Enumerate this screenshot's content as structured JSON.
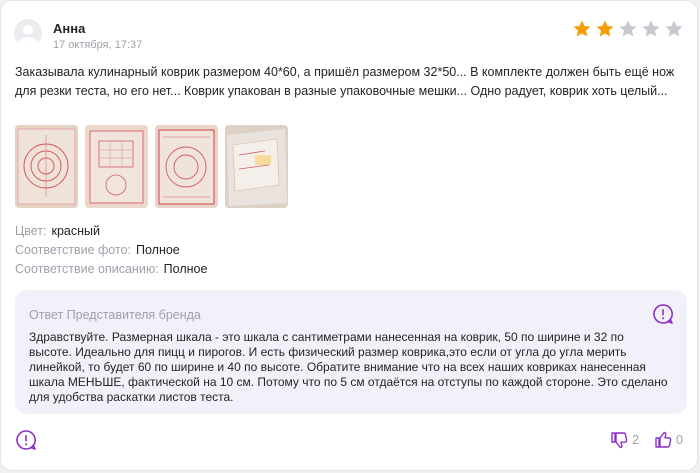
{
  "review": {
    "author": "Анна",
    "date": "17 октября, 17:37",
    "rating": 2,
    "max_rating": 5,
    "text": "Заказывала кулинарный коврик размером 40*60, а пришёл размером 32*50... В комплекте должен быть ещё нож для резки теста, но его нет... Коврик упакован в разные упаковочные мешки... Одно радует, коврик хоть целый...",
    "photos_count": 4,
    "properties": [
      {
        "key": "Цвет:",
        "value": "красный"
      },
      {
        "key": "Соответствие фото:",
        "value": "Полное"
      },
      {
        "key": "Соответствие описанию:",
        "value": "Полное"
      }
    ]
  },
  "answer": {
    "title": "Ответ Представителя бренда",
    "text": "Здравствуйте. Размерная шкала - это шкала с сантиметрами нанесенная на коврик, 50 по ширине и 32 по высоте. Идеально для пицц и пирогов. И есть физический размер коврика,это если от угла до угла мерить линейкой, то будет 60 по ширине и 40 по высоте. Обратите внимание что на всех наших ковриках нанесенная шкала МЕНЬШЕ, фактической на 10 см. Потому что по 5 см отдаётся на отступы по каждой стороне. Это сделано для удобства раскатки листов теста."
  },
  "votes": {
    "dislikes": "2",
    "likes": "0"
  },
  "colors": {
    "star_filled": "#f59e0b",
    "star_empty": "#c8c8ce",
    "accent": "#8b2fc9",
    "answer_bg": "#f2f0f8"
  },
  "icons": {
    "avatar": "user-avatar-icon",
    "answer": "chat-question-icon",
    "comment": "chat-question-icon",
    "dislike": "thumb-down-icon",
    "like": "thumb-up-icon"
  }
}
